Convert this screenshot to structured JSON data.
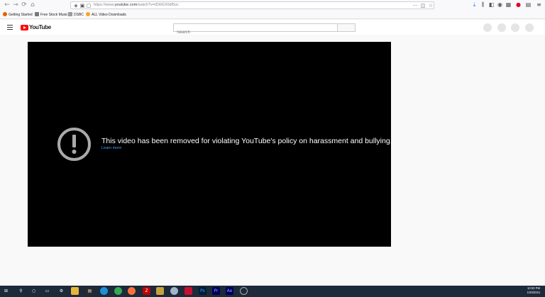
{
  "browser": {
    "url_prefix": "https://www.",
    "url_host": "youtube.com",
    "url_path": "/watch?v=tDHGX0dI5oc",
    "nav": {
      "back": "←",
      "forward": "→",
      "reload": "⟳",
      "home": "⌂"
    },
    "right_icons": [
      "download-icon",
      "library-icon",
      "sidebar-icon",
      "account-icon",
      "extension-icon",
      "pinterest-icon",
      "extension-icon",
      "menu-icon"
    ]
  },
  "bookmarks": [
    {
      "label": "Getting Started",
      "icon": "firefox-icon",
      "color": "#e66000"
    },
    {
      "label": "Free Stock Music",
      "icon": "page-icon",
      "color": "#777777"
    },
    {
      "label": "DSBC",
      "icon": "folder-icon",
      "color": "#9a9aa0"
    },
    {
      "label": "ALL Video Downloads",
      "icon": "site-icon",
      "color": "#f5a623"
    }
  ],
  "youtube": {
    "logo_text": "YouTube",
    "search_placeholder": "Search"
  },
  "player": {
    "message": "This video has been removed for violating YouTube's policy on harassment and bullying.",
    "link": "Learn more"
  },
  "taskbar": {
    "time": "10:02 PM",
    "date": "1/20/2021",
    "apps": [
      "windows-start-icon",
      "search-icon",
      "cortana-icon",
      "task-view-icon",
      "settings-icon",
      "file-explorer-icon",
      "edge-icon",
      "chrome-icon",
      "firefox-icon",
      "filezilla-icon",
      "app-icon",
      "media-icon",
      "app-icon",
      "photoshop-icon",
      "premiere-icon",
      "after-effects-icon",
      "clock-icon"
    ]
  },
  "colors": {
    "accent": "#ff0000",
    "link": "#3ea6ff",
    "player_bg": "#000000",
    "taskbar": "#1c2a3a"
  }
}
